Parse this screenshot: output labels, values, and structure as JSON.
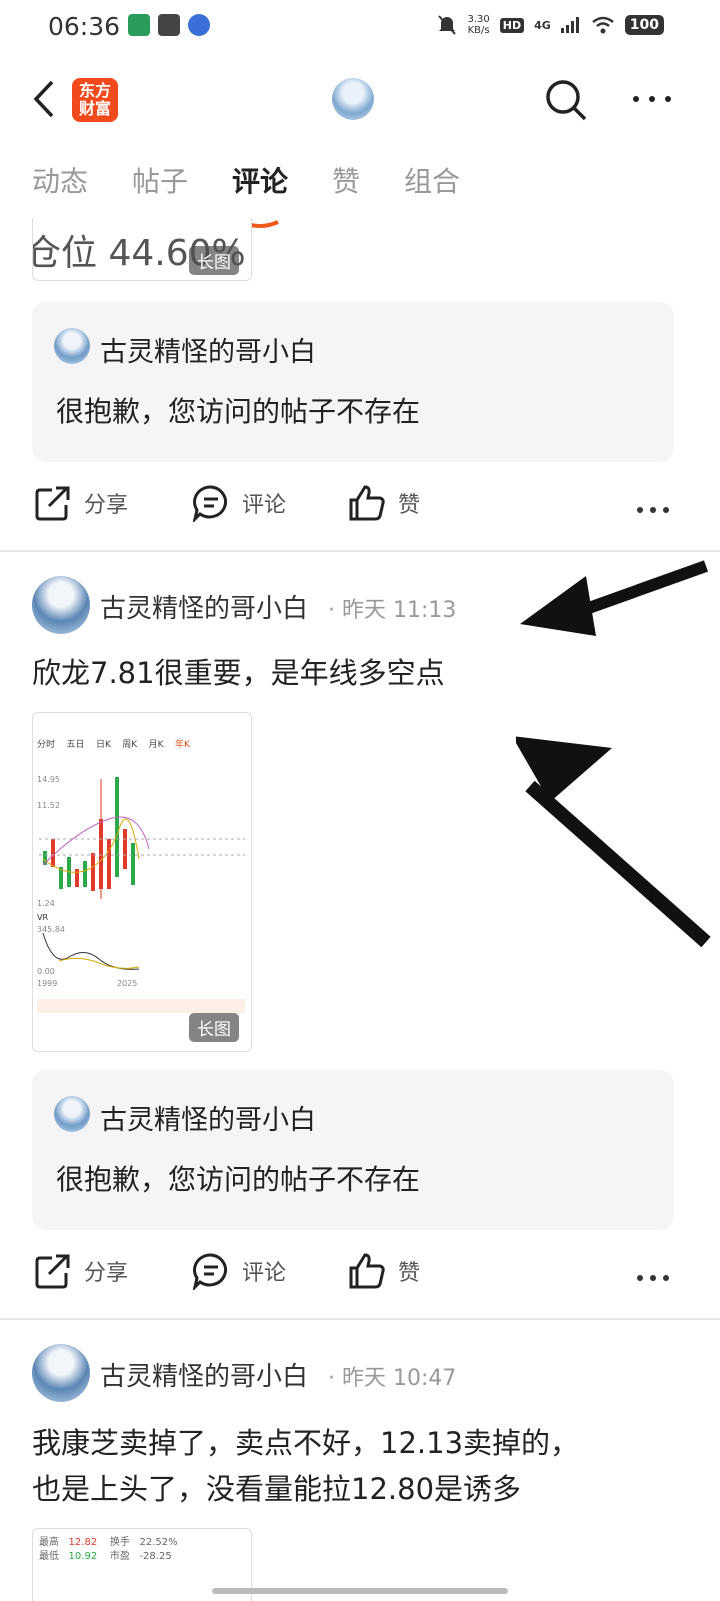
{
  "status": {
    "time": "06:36",
    "net_speed": "3.30",
    "net_unit": "KB/s",
    "hd": "HD",
    "signal": "4G",
    "battery": "100"
  },
  "nav": {
    "logo_line1": "东方",
    "logo_line2": "财富"
  },
  "tabs": [
    {
      "label": "动态"
    },
    {
      "label": "帖子"
    },
    {
      "label": "评论"
    },
    {
      "label": "赞"
    },
    {
      "label": "组合"
    }
  ],
  "top_image": {
    "text": "仓位  44.60%",
    "tag": "长图"
  },
  "post1": {
    "quote_name": "古灵精怪的哥小白",
    "quote_text": "很抱歉，您访问的帖子不存在"
  },
  "actions": {
    "share": "分享",
    "comment": "评论",
    "like": "赞"
  },
  "post2": {
    "author": "古灵精怪的哥小白",
    "time": "· 昨天 11:13",
    "text": "欣龙7.81很重要，是年线多空点",
    "image_tag": "长图",
    "chart_tabs": [
      "分时",
      "五日",
      "日K",
      "周K",
      "月K",
      "年K"
    ],
    "chart_labels": [
      "14.95",
      "11.52",
      "1.24",
      "VR",
      "2025",
      "1999",
      "345.84",
      "0.00"
    ],
    "quote_name": "古灵精怪的哥小白",
    "quote_text": "很抱歉，您访问的帖子不存在"
  },
  "post3": {
    "author": "古灵精怪的哥小白",
    "time": "· 昨天 10:47",
    "text_line1": "我康芝卖掉了，卖点不好，12.13卖掉的，",
    "text_line2": "也是上头了，没看量能拉12.80是诱多",
    "thumb_row1": [
      "最高",
      "12.82",
      "换手",
      "22.52%"
    ],
    "thumb_row2": [
      "最低",
      "10.92",
      "市盈",
      "-28.25"
    ]
  }
}
